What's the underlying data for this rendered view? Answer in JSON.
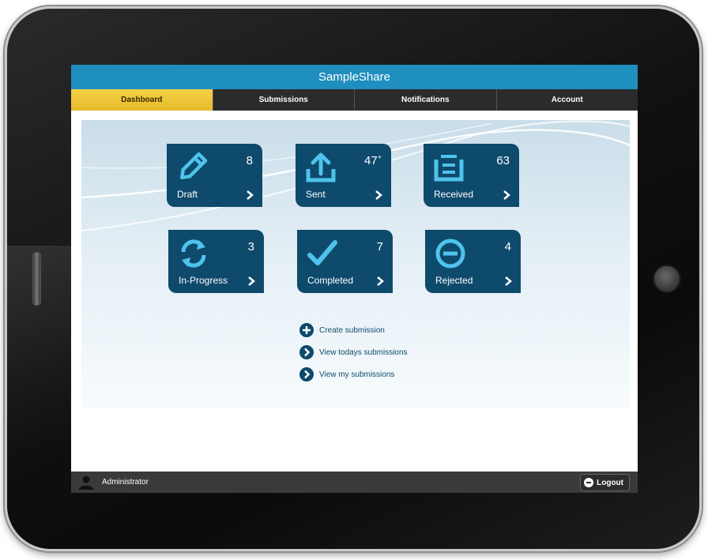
{
  "app": {
    "title": "SampleShare"
  },
  "nav": {
    "tabs": [
      {
        "label": "Dashboard",
        "active": true
      },
      {
        "label": "Submissions",
        "active": false
      },
      {
        "label": "Notifications",
        "active": false
      },
      {
        "label": "Account",
        "active": false
      }
    ]
  },
  "tiles": [
    {
      "label": "Draft",
      "count": "8",
      "count_suffix": "",
      "icon": "pencil-icon"
    },
    {
      "label": "Sent",
      "count": "47",
      "count_suffix": "+",
      "icon": "upload-icon"
    },
    {
      "label": "Received",
      "count": "63",
      "count_suffix": "",
      "icon": "inbox-icon"
    },
    {
      "label": "In-Progress",
      "count": "3",
      "count_suffix": "",
      "icon": "refresh-icon"
    },
    {
      "label": "Completed",
      "count": "7",
      "count_suffix": "",
      "icon": "checkmark-icon"
    },
    {
      "label": "Rejected",
      "count": "4",
      "count_suffix": "",
      "icon": "minus-circle-icon"
    }
  ],
  "links": [
    {
      "label": "Create submission",
      "icon": "plus-circle-icon"
    },
    {
      "label": "View todays submissions",
      "icon": "chevron-circle-icon"
    },
    {
      "label": "View my submissions",
      "icon": "chevron-circle-icon"
    }
  ],
  "status": {
    "user": "Administrator",
    "logout_label": "Logout"
  },
  "colors": {
    "title_bar": "#1f8fbf",
    "tile": "#0e4a6c",
    "active_tab": "#f4d246",
    "nav_bar": "#2b2b2b",
    "status_bar": "#3a3a3a"
  }
}
